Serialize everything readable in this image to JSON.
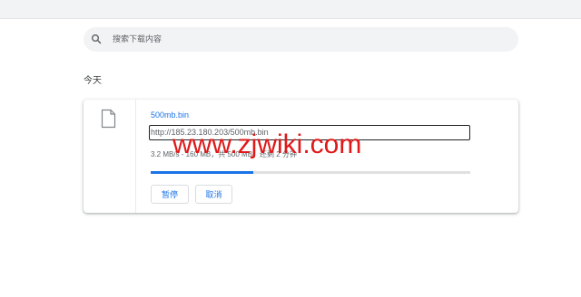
{
  "search": {
    "placeholder": "搜索下载内容",
    "icon": "search-icon"
  },
  "section": {
    "heading": "今天"
  },
  "download": {
    "file_name": "500mb.bin",
    "url": "http://185.23.180.203/500mb.bin",
    "status": "3.2 MB/s - 160 MB，共 500 MB，还剩 2 分钟",
    "progress_fraction": 0.32,
    "file_icon": "file-icon",
    "buttons": {
      "pause": "暂停",
      "cancel": "取消"
    }
  },
  "watermark": {
    "text": "www.zjwiki.com"
  },
  "colors": {
    "accent": "#1a73e8",
    "watermark": "#e01818"
  }
}
